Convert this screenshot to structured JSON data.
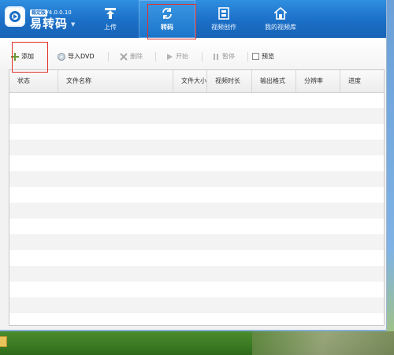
{
  "header": {
    "logo_badge": "稳定版",
    "version": "V4.0.0.10",
    "app_name": "易转码",
    "nav": [
      {
        "label": "上传",
        "icon": "upload-icon"
      },
      {
        "label": "转码",
        "icon": "convert-icon",
        "active": true
      },
      {
        "label": "视频创作",
        "icon": "film-icon"
      },
      {
        "label": "我的视频库",
        "icon": "home-icon"
      }
    ]
  },
  "toolbar": {
    "add_label": "添加",
    "import_dvd_label": "导入DVD",
    "delete_label": "删除",
    "start_label": "开始",
    "pause_label": "暂停",
    "preview_label": "预览"
  },
  "table": {
    "columns": [
      "状态",
      "文件名称",
      "文件大小",
      "视频时长",
      "输出格式",
      "分辨率",
      "进度"
    ],
    "rows": []
  },
  "colors": {
    "header_blue": "#1b6fc6",
    "annotation_red": "#e0302a"
  }
}
